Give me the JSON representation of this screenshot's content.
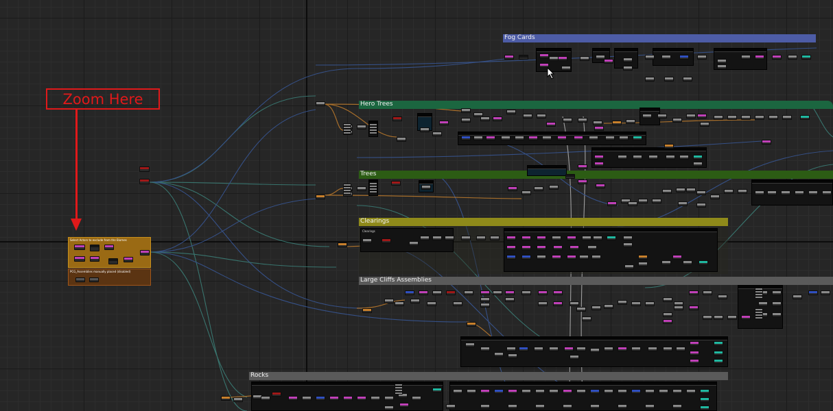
{
  "annotation": {
    "zoom_label": "Zoom Here"
  },
  "comments": {
    "fog_cards": {
      "title": "Fog Cards",
      "color": "#4d5ca6"
    },
    "hero_trees": {
      "title": "Hero Trees",
      "color": "#1b6640"
    },
    "trees": {
      "title": "Trees",
      "color": "#2c5c14"
    },
    "clearings": {
      "title": "Clearings",
      "color": "#8f8a1a",
      "sub_title": "Clearings"
    },
    "large_cliffs": {
      "title": "Large Cliffs Assemblies",
      "color": "#5a5a5a"
    },
    "rocks": {
      "title": "Rocks",
      "color": "#5a5a5a"
    },
    "select_actors": {
      "title": "Select Actors to exclude from the Biomes",
      "color": "#b07a1a"
    },
    "pcg_assemblies": {
      "title": "PCG_Assemblies manually placed (disabled)",
      "color": "#b0581a"
    }
  },
  "colors": {
    "wire_blue": "#3b5fa8",
    "wire_teal": "#3f8f86",
    "wire_orange": "#c8802c",
    "wire_white": "#c9c9c9",
    "pin_pink": "#c040b8",
    "pin_teal": "#20b8a0",
    "annotation_red": "#e0191a"
  },
  "icons": {
    "cursor": "mouse-pointer-icon"
  }
}
